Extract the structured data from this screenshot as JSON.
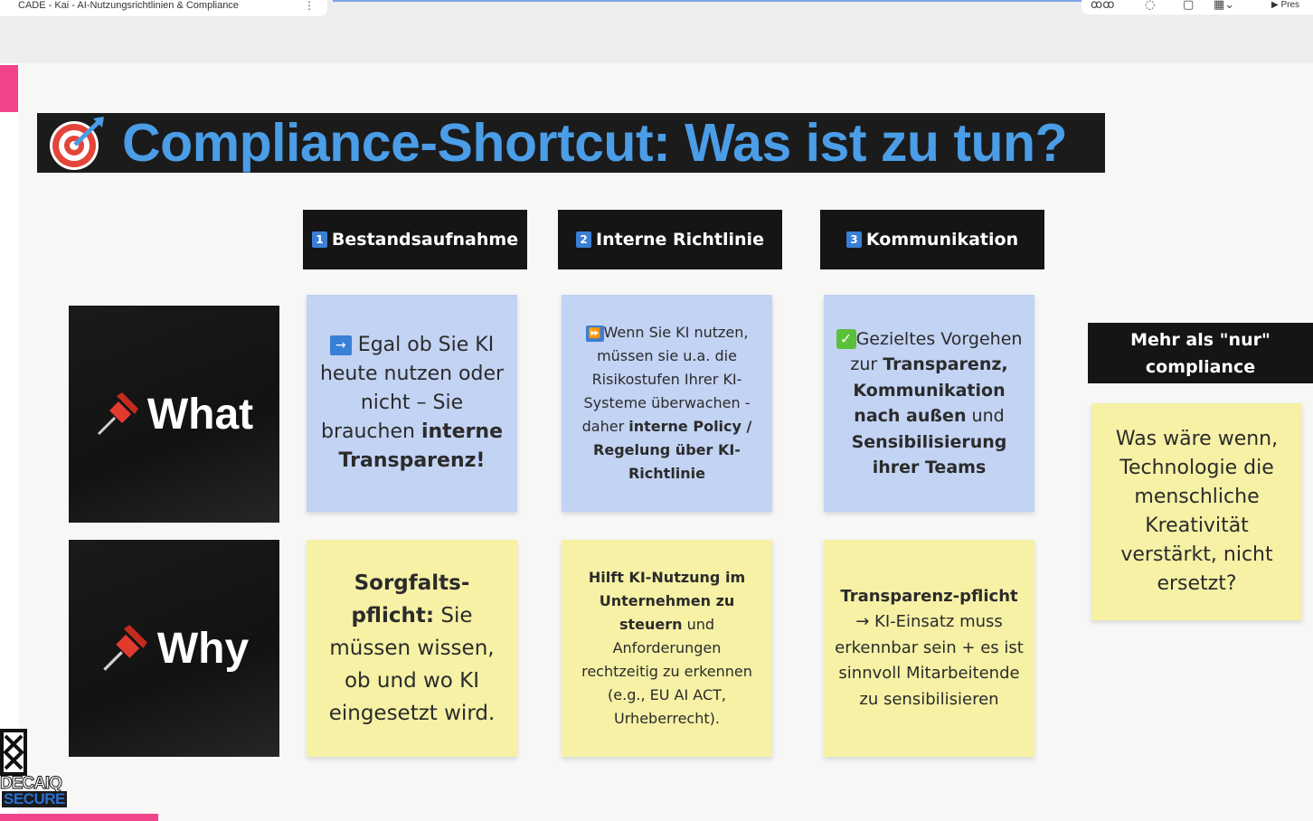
{
  "app": {
    "tab_title": "CADE - Kai - AI-Nutzungsrichtlinien & Compliance",
    "present_label": "Pres"
  },
  "slide": {
    "title": "Compliance-Shortcut: Was ist zu tun?",
    "title_icon": "bullseye-dart-icon",
    "columns": [
      {
        "number": "1",
        "label": "Bestandsaufnahme"
      },
      {
        "number": "2",
        "label": "Interne Richtlinie"
      },
      {
        "number": "3",
        "label": "Kommunikation"
      }
    ],
    "rows": [
      {
        "label": "What",
        "icon": "pushpin-icon"
      },
      {
        "label": "Why",
        "icon": "pushpin-icon"
      }
    ],
    "what": {
      "c1": {
        "icon": "right-arrow-box-icon",
        "plain": "Egal ob Sie KI heute nutzen oder nicht – Sie brauchen",
        "bold": "interne Transparenz!"
      },
      "c2": {
        "icon": "fast-forward-box-icon",
        "plain": "Wenn Sie KI nutzen, müssen sie u.a. die Risikostufen Ihrer KI-Systeme überwachen - daher",
        "bold": "interne Policy / Regelung über KI-Richtlinie"
      },
      "c3": {
        "icon": "check-box-icon",
        "p1": "Gezieltes Vorgehen zur",
        "b1": "Transparenz, Kommunikation nach außen",
        "p2": "und",
        "b2": "Sensibilisierung ihrer Teams"
      }
    },
    "why": {
      "c1": {
        "bold": "Sorgfalts-pflicht:",
        "plain": "Sie müssen wissen, ob und wo KI eingesetzt wird."
      },
      "c2": {
        "bold": "Hilft KI-Nutzung im Unternehmen zu steuern",
        "plain": "und Anforderungen rechtzeitig zu erkennen (e.g., EU AI ACT, Urheberrecht)."
      },
      "c3": {
        "bold": "Transparenz-pflicht",
        "plain": "→ KI-Einsatz muss erkennbar sein + es ist sinnvoll Mitarbeitende zu sensibilisieren"
      }
    },
    "side": {
      "header": "Mehr als \"nur\" compliance",
      "note": "Was wäre wenn, Technologie die menschliche Kreativität verstärkt, nicht ersetzt?"
    },
    "logo": {
      "word1": "DECAIQ",
      "word2": "SECURE"
    }
  },
  "colors": {
    "title_blue": "#4a9de6",
    "note_blue": "#c2d3f3",
    "note_yellow": "#f6f1a5",
    "accent_pink": "#f0448b",
    "header_black": "#151515"
  }
}
